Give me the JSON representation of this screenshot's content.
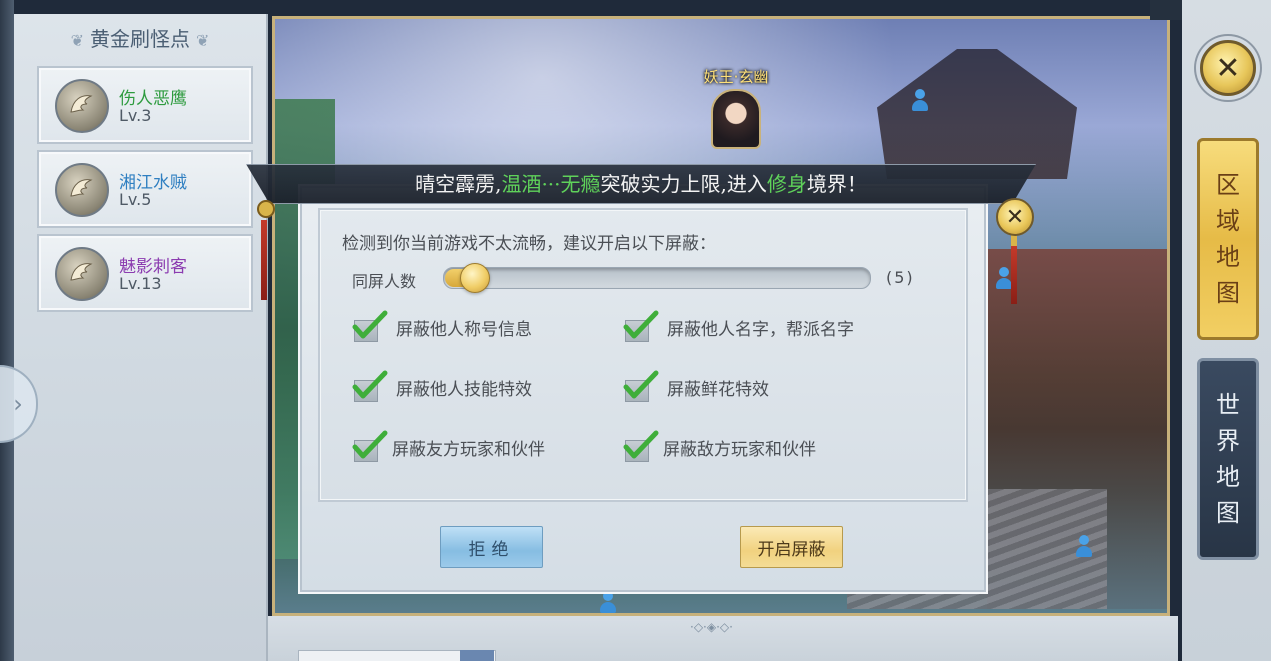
{
  "left_panel": {
    "title": "黄金刷怪点",
    "spots": [
      {
        "name": "伤人恶鹰",
        "level": "Lv.3",
        "color": "#2e9b3f"
      },
      {
        "name": "湘江水贼",
        "level": "Lv.5",
        "color": "#2f7fc1"
      },
      {
        "name": "魅影刺客",
        "level": "Lv.13",
        "color": "#8b3bb0"
      }
    ],
    "expand_glyph": "›"
  },
  "map": {
    "npc_name": "妖王·玄幽"
  },
  "right_panel": {
    "close_glyph": "✕",
    "region_tab": [
      "区",
      "域",
      "地",
      "图"
    ],
    "world_tab": [
      "世",
      "界",
      "地",
      "图"
    ]
  },
  "banner": {
    "text_1": "晴空霹雳,",
    "text_2": "温酒···无瘾",
    "text_3": "突破实力上限,进入",
    "text_4": "修身",
    "text_5": "境界！"
  },
  "dialog": {
    "close_glyph": "✕",
    "notice": "检测到你当前游戏不太流畅，建议开启以下屏蔽：",
    "slider": {
      "label": "同屏人数",
      "value": 5,
      "min": 5,
      "max": 30,
      "value_text": "(5)"
    },
    "options": [
      {
        "label": "屏蔽他人称号信息",
        "checked": true
      },
      {
        "label": "屏蔽他人名字，帮派名字",
        "checked": true
      },
      {
        "label": "屏蔽他人技能特效",
        "checked": true
      },
      {
        "label": "屏蔽鲜花特效",
        "checked": true
      },
      {
        "label": "屏蔽友方玩家和伙伴",
        "checked": true
      },
      {
        "label": "屏蔽敌方玩家和伙伴",
        "checked": true
      }
    ],
    "refuse_label": "拒绝",
    "enable_label": "开启屏蔽"
  },
  "colors": {
    "accent_gold": "#e6bb47",
    "check_green": "#3fae3a",
    "banner_green": "#5fd25a"
  }
}
